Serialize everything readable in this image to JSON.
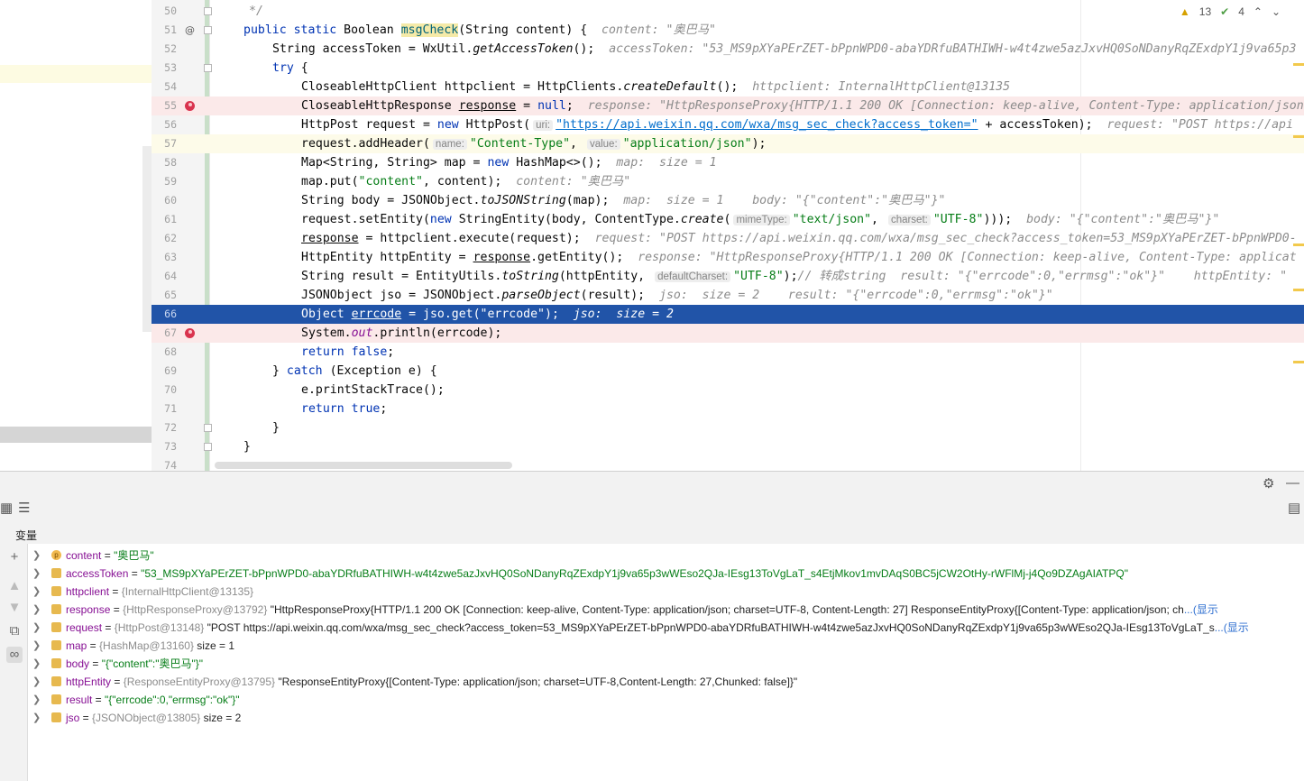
{
  "editor": {
    "indicators": {
      "warnings": "13",
      "checks": "4"
    },
    "lines": [
      {
        "num": "50"
      },
      {
        "num": "51",
        "gutter": "@"
      },
      {
        "num": "52"
      },
      {
        "num": "53"
      },
      {
        "num": "54"
      },
      {
        "num": "55"
      },
      {
        "num": "56"
      },
      {
        "num": "57"
      },
      {
        "num": "58"
      },
      {
        "num": "59"
      },
      {
        "num": "60"
      },
      {
        "num": "61"
      },
      {
        "num": "62"
      },
      {
        "num": "63"
      },
      {
        "num": "64"
      },
      {
        "num": "65"
      },
      {
        "num": "66"
      },
      {
        "num": "67"
      },
      {
        "num": "68"
      },
      {
        "num": "69"
      },
      {
        "num": "70"
      },
      {
        "num": "71"
      },
      {
        "num": "72"
      },
      {
        "num": "73"
      },
      {
        "num": "74"
      }
    ],
    "code": {
      "l50": "*/",
      "l51_kw": "public static",
      "l51_type": "Boolean",
      "l51_name": "msgCheck",
      "l51_sig": "(String content) {",
      "l51_hint": "content: \"奥巴马\"",
      "l52_a": "String accessToken = WxUtil.",
      "l52_b": "getAccessToken",
      "l52_c": "();",
      "l52_hint": "accessToken: \"53_MS9pXYaPErZET-bPpnWPD0-abaYDRfuBATHIWH-w4t4zwe5azJxvHQ0SoNDanyRqZExdpY1j9va65p3",
      "l53": "try",
      "l53_b": "{",
      "l54_a": "CloseableHttpClient httpclient = HttpClients.",
      "l54_b": "createDefault",
      "l54_c": "();",
      "l54_hint": "httpclient: InternalHttpClient@13135",
      "l55_a": "CloseableHttpResponse",
      "l55_b": "response",
      "l55_c": "=",
      "l55_d": "null",
      "l55_e": ";",
      "l55_hint": "response: \"HttpResponseProxy{HTTP/1.1 200 OK [Connection: keep-alive, Content-Type: application/json",
      "l56_a": "HttpPost request =",
      "l56_new": "new",
      "l56_b": "HttpPost(",
      "l56_param": "uri:",
      "l56_url": "\"https://api.weixin.qq.com/wxa/msg_sec_check?access_token=\"",
      "l56_c": "+ accessToken);",
      "l56_hint": "request: \"POST https://api",
      "l57_a": "request.addHeader(",
      "l57_p1": "name:",
      "l57_s1": "\"Content-Type\"",
      "l57_comma": ",",
      "l57_p2": "value:",
      "l57_s2": "\"application/json\"",
      "l57_end": ");",
      "l58_a": "Map<String, String> map =",
      "l58_new": "new",
      "l58_b": "HashMap<>();",
      "l58_hint": "map:  size = 1",
      "l59_a": "map.put(",
      "l59_s": "\"content\"",
      "l59_b": ", content);",
      "l59_hint": "content: \"奥巴马\"",
      "l60_a": "String body = JSONObject.",
      "l60_b": "toJSONString",
      "l60_c": "(map);",
      "l60_hint": "map:  size = 1    body: \"{\"content\":\"奥巴马\"}\"",
      "l61_a": "request.setEntity(",
      "l61_new": "new",
      "l61_b": "StringEntity(body, ContentType.",
      "l61_c": "create",
      "l61_d": "(",
      "l61_p1": "mimeType:",
      "l61_s1": "\"text/json\"",
      "l61_comma": ",",
      "l61_p2": "charset:",
      "l61_s2": "\"UTF-8\"",
      "l61_end": ")));",
      "l61_hint": "body: \"{\"content\":\"奥巴马\"}\"",
      "l62_a": "response",
      "l62_b": "= httpclient.execute(request);",
      "l62_hint": "request: \"POST https://api.weixin.qq.com/wxa/msg_sec_check?access_token=53_MS9pXYaPErZET-bPpnWPD0-",
      "l63_a": "HttpEntity httpEntity =",
      "l63_b": "response",
      "l63_c": ".getEntity();",
      "l63_hint": "response: \"HttpResponseProxy{HTTP/1.1 200 OK [Connection: keep-alive, Content-Type: applicat",
      "l64_a": "String result = EntityUtils.",
      "l64_b": "toString",
      "l64_c": "(httpEntity,",
      "l64_p": "defaultCharset:",
      "l64_s": "\"UTF-8\"",
      "l64_d": ");",
      "l64_cm": "// 转成string",
      "l64_hint": "result: \"{\"errcode\":0,\"errmsg\":\"ok\"}\"    httpEntity: \"",
      "l65_a": "JSONObject jso = JSONObject.",
      "l65_b": "parseObject",
      "l65_c": "(result);",
      "l65_hint": "jso:  size = 2    result: \"{\"errcode\":0,\"errmsg\":\"ok\"}\"",
      "l66_a": "Object",
      "l66_b": "errcode",
      "l66_c": "= jso.get(",
      "l66_s": "\"errcode\"",
      "l66_d": ");",
      "l66_hint": "jso:  size = 2",
      "l67_a": "System.",
      "l67_b": "out",
      "l67_c": ".println(errcode);",
      "l68_kw": "return",
      "l68_kw2": "false",
      "l68_end": ";",
      "l69_a": "}",
      "l69_kw": "catch",
      "l69_b": "(Exception e) {",
      "l70": "e.printStackTrace();",
      "l71_kw": "return",
      "l71_kw2": "true",
      "l71_end": ";",
      "l72": "}",
      "l73": "}"
    }
  },
  "debug": {
    "panel_title": "变量",
    "variables": [
      {
        "icon": "p",
        "name": "content",
        "eq": " = ",
        "type": "",
        "value": "\"奥巴马\"",
        "kind": "str"
      },
      {
        "icon": "",
        "name": "accessToken",
        "eq": " = ",
        "type": "",
        "value": "\"53_MS9pXYaPErZET-bPpnWPD0-abaYDRfuBATHIWH-w4t4zwe5azJxvHQ0SoNDanyRqZExdpY1j9va65p3wWEso2QJa-IEsg13ToVgLaT_s4EtjMkov1mvDAqS0BC5jCW2OtHy-rWFlMj-j4Qo9DZAgAIATPQ\"",
        "kind": "str"
      },
      {
        "icon": "",
        "name": "httpclient",
        "eq": " = ",
        "type": "{InternalHttpClient@13135}",
        "value": "",
        "kind": "obj"
      },
      {
        "icon": "",
        "name": "response",
        "eq": " = ",
        "type": "{HttpResponseProxy@13792}",
        "value": " \"HttpResponseProxy{HTTP/1.1 200 OK [Connection: keep-alive, Content-Type: application/json; charset=UTF-8, Content-Length: 27] ResponseEntityProxy{[Content-Type: application/json; ch",
        "more": "...(显示",
        "kind": "obj"
      },
      {
        "icon": "",
        "name": "request",
        "eq": " = ",
        "type": "{HttpPost@13148}",
        "value": " \"POST https://api.weixin.qq.com/wxa/msg_sec_check?access_token=53_MS9pXYaPErZET-bPpnWPD0-abaYDRfuBATHIWH-w4t4zwe5azJxvHQ0SoNDanyRqZExdpY1j9va65p3wWEso2QJa-IEsg13ToVgLaT_s",
        "more": "...(显示",
        "kind": "obj"
      },
      {
        "icon": "",
        "name": "map",
        "eq": " = ",
        "type": "{HashMap@13160}",
        "value": "  size = 1",
        "kind": "obj"
      },
      {
        "icon": "",
        "name": "body",
        "eq": " = ",
        "type": "",
        "value": "\"{\"content\":\"奥巴马\"}\"",
        "kind": "str"
      },
      {
        "icon": "",
        "name": "httpEntity",
        "eq": " = ",
        "type": "{ResponseEntityProxy@13795}",
        "value": " \"ResponseEntityProxy{[Content-Type: application/json; charset=UTF-8,Content-Length: 27,Chunked: false]}\"",
        "kind": "obj"
      },
      {
        "icon": "",
        "name": "result",
        "eq": " = ",
        "type": "",
        "value": "\"{\"errcode\":0,\"errmsg\":\"ok\"}\"",
        "kind": "str"
      },
      {
        "icon": "",
        "name": "jso",
        "eq": " = ",
        "type": "{JSONObject@13805}",
        "value": "  size = 2",
        "kind": "obj"
      }
    ]
  },
  "colors": {
    "execution_line": "#2154a8",
    "breakpoint": "#d9334e",
    "string": "#067d17",
    "keyword": "#0033b3"
  }
}
